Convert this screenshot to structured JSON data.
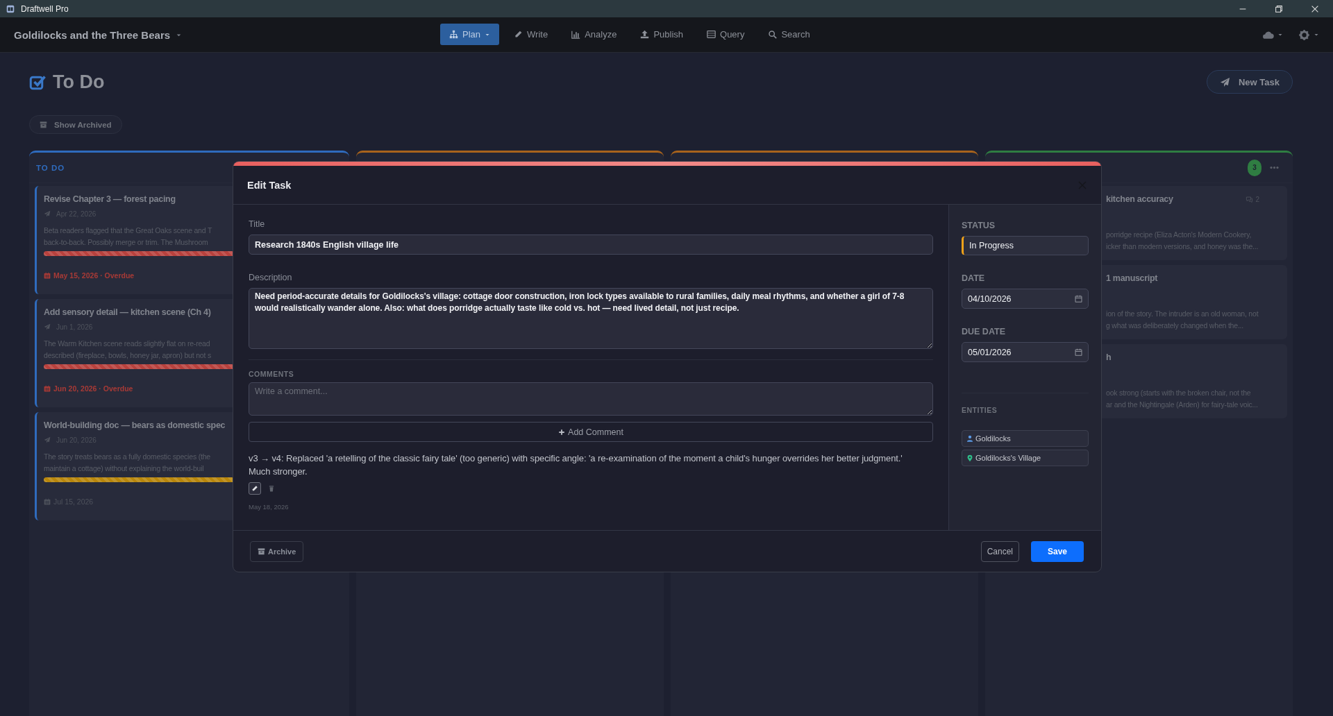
{
  "window": {
    "title": "Draftwell Pro"
  },
  "navbar": {
    "project": "Goldilocks and the Three Bears",
    "tabs": [
      {
        "label": "Plan",
        "selected": true,
        "has_menu": true
      },
      {
        "label": "Write",
        "selected": false,
        "has_menu": false
      },
      {
        "label": "Analyze",
        "selected": false,
        "has_menu": false
      },
      {
        "label": "Publish",
        "selected": false,
        "has_menu": false
      },
      {
        "label": "Query",
        "selected": false,
        "has_menu": false
      },
      {
        "label": "Search",
        "selected": false,
        "has_menu": false
      }
    ]
  },
  "page": {
    "heading": "To Do",
    "new_task": "New Task",
    "show_archived": "Show Archived"
  },
  "columns": [
    {
      "title": "TO DO",
      "color": "#2f6bbd",
      "cards": [
        {
          "title": "Revise Chapter 3 — forest pacing",
          "date": "Apr 22, 2026",
          "description_lines": [
            "Beta readers flagged that the Great Oaks scene and T",
            "back-to-back. Possibly merge or trim. The Mushroom"
          ],
          "color": "#b8413d",
          "due": "May 15, 2026 · Overdue",
          "overdue": true
        },
        {
          "title": "Add sensory detail — kitchen scene (Ch 4)",
          "date": "Jun 1, 2026",
          "description_lines": [
            "The Warm Kitchen scene reads slightly flat on re-read",
            "described (fireplace, bowls, honey jar, apron) but not s"
          ],
          "color": "#b8413d",
          "due": "Jun 20, 2026 · Overdue",
          "overdue": true
        },
        {
          "title": "World-building doc — bears as domestic spec",
          "date": "Jun 20, 2026",
          "description_lines": [
            "The story treats bears as a fully domestic species (the",
            "maintain a cottage) without explaining the world-buil"
          ],
          "color": "#b8860b",
          "due": "Jul 15, 2026",
          "overdue": false
        }
      ]
    },
    {
      "color": "#a8631c"
    },
    {
      "color": "#a8631c"
    },
    {
      "color": "#2f7d42",
      "count": "3",
      "cards": [
        {
          "title": "kitchen accuracy",
          "comments": "2",
          "description_lines": [
            "porridge recipe (Eliza Acton's Modern Cookery,",
            "icker than modern versions, and honey was the..."
          ]
        },
        {
          "title": "1 manuscript",
          "description_lines": [
            "ion of the story. The intruder is an old woman, not",
            "g what was deliberately changed when the..."
          ]
        },
        {
          "title": "h",
          "description_lines": [
            "ook strong (starts with the broken chair, not the",
            "ar and the Nightingale (Arden) for fairy-tale voic..."
          ]
        }
      ]
    }
  ],
  "modal": {
    "title": "Edit Task",
    "title_label": "Title",
    "title_value": "Research 1840s English village life",
    "description_label": "Description",
    "description": "Need period-accurate details for Goldilocks's village: cottage door construction, iron lock types available to rural families, daily meal rhythms, and whether a girl of 7-8 would realistically wander alone. Also: what does porridge actually taste like cold vs. hot — need lived detail, not just recipe.",
    "comments": {
      "heading": "COMMENTS",
      "placeholder": "Write a comment...",
      "add_button": "Add Comment",
      "items": [
        {
          "text": "v3 → v4: Replaced 'a retelling of the classic fairy tale' (too generic) with specific angle: 'a re-examination of the moment a child's hunger overrides her better judgment.' Much stronger.",
          "date": "May 18, 2026"
        }
      ]
    },
    "sidebar": {
      "status_label": "STATUS",
      "status": "In Progress",
      "date_label": "DATE",
      "date": "04/10/2026",
      "due_label": "DUE DATE",
      "due": "05/01/2026",
      "entities_label": "ENTITIES",
      "entities": [
        {
          "kind": "character",
          "name": "Goldilocks"
        },
        {
          "kind": "location",
          "name": "Goldilocks's Village"
        }
      ]
    },
    "buttons": {
      "archive": "Archive",
      "cancel": "Cancel",
      "save": "Save"
    }
  }
}
